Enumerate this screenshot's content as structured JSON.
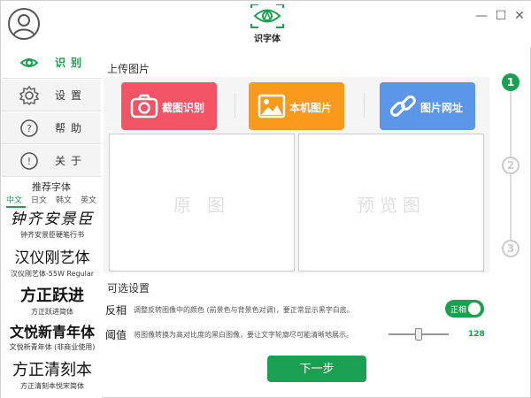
{
  "app": {
    "logo_text": "识字体",
    "window_controls": {
      "minimize": "—",
      "maximize": "☐",
      "close": "✕"
    }
  },
  "sidebar": {
    "items": [
      {
        "label": "识别",
        "icon": "eye-icon",
        "active": true
      },
      {
        "label": "设置",
        "icon": "gear-icon",
        "active": false
      },
      {
        "label": "帮助",
        "icon": "help-icon",
        "active": false
      },
      {
        "label": "关于",
        "icon": "info-icon",
        "active": false
      }
    ],
    "recommend_title": "推荐字体",
    "lang_tabs": [
      {
        "label": "中文",
        "active": true
      },
      {
        "label": "日文",
        "active": false
      },
      {
        "label": "韩文",
        "active": false
      },
      {
        "label": "英文",
        "active": false
      }
    ],
    "fonts": [
      {
        "sample": "钟齐安景臣",
        "caption": "钟齐安景臣硬笔行书"
      },
      {
        "sample": "汉仪刚艺体",
        "caption": "汉仪刚艺体-55W Regular"
      },
      {
        "sample": "方正跃进",
        "caption": "方正跃进简体"
      },
      {
        "sample": "文悦新青年体",
        "caption": "文悦新青年体 (非商业使用)"
      },
      {
        "sample": "方正清刻本",
        "caption": "方正清刻本悦宋简体"
      }
    ]
  },
  "upload": {
    "title": "上传图片",
    "buttons": [
      {
        "label": "截图识别",
        "icon": "camera-icon",
        "color": "#f25466"
      },
      {
        "label": "本机图片",
        "icon": "image-icon",
        "color": "#f99a1c"
      },
      {
        "label": "图片网址",
        "icon": "link-icon",
        "color": "#5b96e9"
      }
    ],
    "original_label": "原 图",
    "preview_label": "预览图"
  },
  "options": {
    "title": "可选设置",
    "invert": {
      "label": "反相",
      "desc": "调整反转图像中的颜色 (前景色与背景色对调)，要正常显示黑字白底。",
      "toggle_text": "正相"
    },
    "threshold": {
      "label": "阈值",
      "desc": "将图像转换为高对比度的黑白图像，要让文字轮廓尽可能清晰地展示。",
      "value": "128",
      "fraction": 0.5
    }
  },
  "next_label": "下一步",
  "steps": [
    {
      "number": "1",
      "active": true
    },
    {
      "number": "2",
      "active": false
    },
    {
      "number": "3",
      "active": false
    }
  ],
  "colors": {
    "accent": "#1aa050"
  }
}
